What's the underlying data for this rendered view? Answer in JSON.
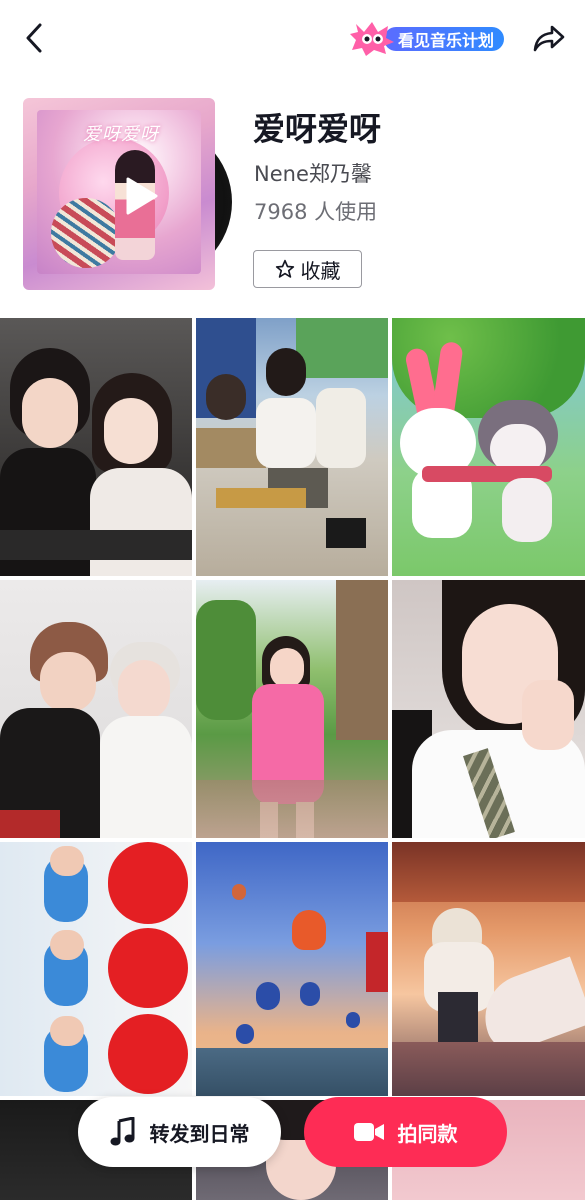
{
  "topbar": {
    "back_icon": "chevron-left-icon",
    "music_plan_label": "看见音乐计划",
    "share_icon": "share-arrow-icon",
    "music_plan_color": "#3b7bff"
  },
  "song": {
    "title": "爱呀爱呀",
    "artist": "Nene郑乃馨",
    "usage": "7968 人使用",
    "favorite_label": "收藏",
    "cover_art_text": "爱呀爱呀"
  },
  "grid": {
    "tiles": [
      {
        "name": "video-two-girls-selfie"
      },
      {
        "name": "video-classroom-girls"
      },
      {
        "name": "video-cartoon-bunny"
      },
      {
        "name": "video-couple-jackets"
      },
      {
        "name": "video-girl-pink-outfit"
      },
      {
        "name": "video-girl-uniform"
      },
      {
        "name": "video-boy-red-balloon-collage"
      },
      {
        "name": "video-hot-air-balloons"
      },
      {
        "name": "video-sunset-anime-girl"
      },
      {
        "name": "video-partial-dark"
      },
      {
        "name": "video-partial-girl"
      },
      {
        "name": "video-partial-pink"
      }
    ]
  },
  "actions": {
    "repost_label": "转发到日常",
    "repost_icon": "music-note-icon",
    "shoot_label": "拍同款",
    "shoot_icon": "video-camera-icon",
    "accent_color": "#fe2c55"
  }
}
